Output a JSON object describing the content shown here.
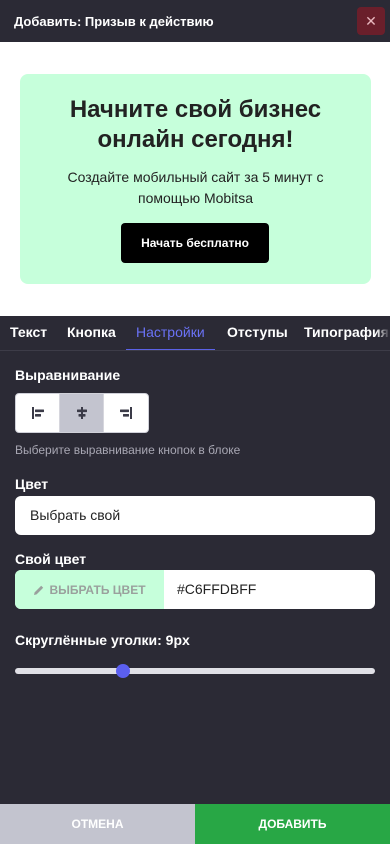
{
  "header": {
    "title": "Добавить: Призыв к действию",
    "close_icon": "close-icon"
  },
  "preview": {
    "title": "Начните свой бизнес онлайн сегодня!",
    "subtitle": "Создайте мобильный сайт за 5 минут с помощью Mobitsa",
    "button_label": "Начать бесплатно",
    "background_color": "#C6FFDB"
  },
  "tabs": [
    {
      "label": "Текст",
      "active": false
    },
    {
      "label": "Кнопка",
      "active": false
    },
    {
      "label": "Настройки",
      "active": true
    },
    {
      "label": "Отступы",
      "active": false
    },
    {
      "label": "Типография",
      "active": false
    }
  ],
  "settings": {
    "alignment": {
      "label": "Выравнивание",
      "hint": "Выберите выравнивание кнопок в блоке",
      "options": [
        "align-left-icon",
        "align-center-icon",
        "align-right-icon"
      ],
      "selected": "center"
    },
    "color": {
      "label": "Цвет",
      "value": "Выбрать свой"
    },
    "custom_color": {
      "label": "Свой цвет",
      "pick_label": "ВЫБРАТЬ ЦВЕТ",
      "pick_icon": "pencil-icon",
      "value": "#C6FFDBFF"
    },
    "radius": {
      "label": "Скруглённые уголки: 9px",
      "value_fraction": 0.3
    }
  },
  "footer": {
    "cancel_label": "ОТМЕНА",
    "add_label": "ДОБАВИТЬ"
  },
  "colors": {
    "accent": "#5B62E6",
    "add": "#28A745",
    "cancel": "#C3C4CF",
    "panel": "#2B2A35",
    "close": "#6A1F2B"
  }
}
